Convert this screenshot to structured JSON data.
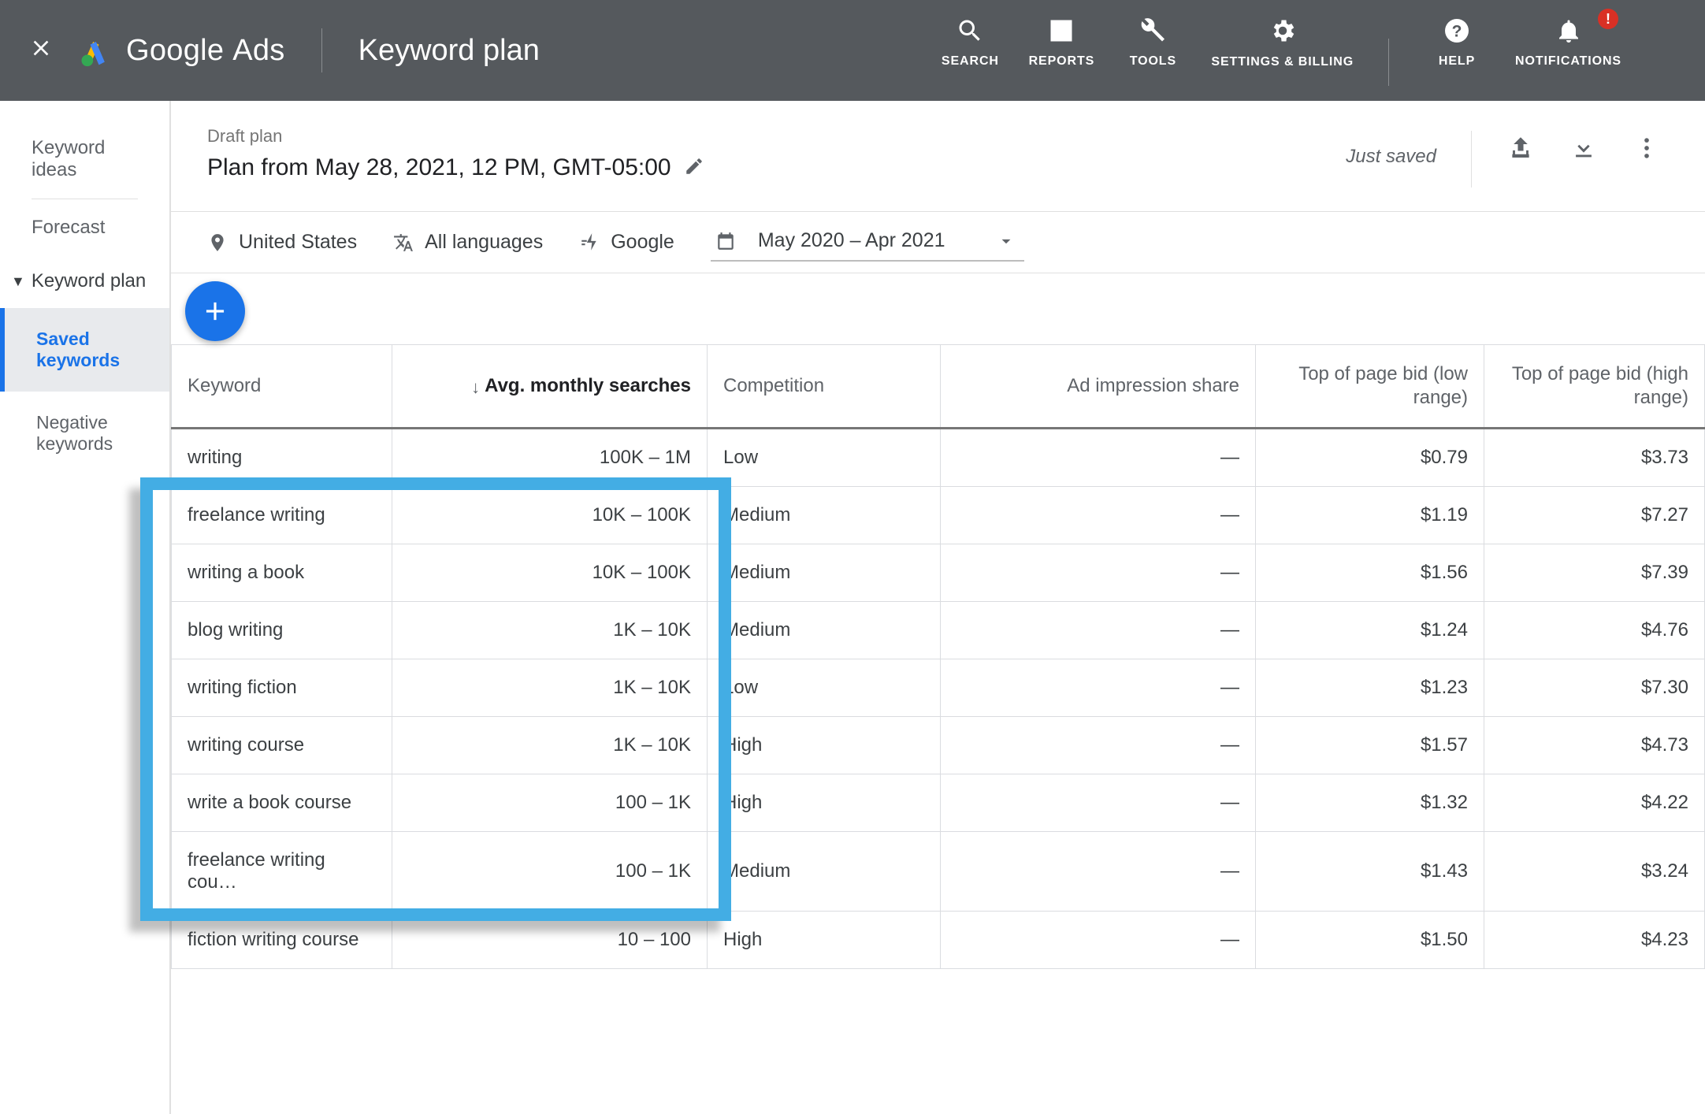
{
  "topbar": {
    "brand": "Google",
    "brand_suffix": "Ads",
    "page_title": "Keyword plan",
    "actions": {
      "search": "SEARCH",
      "reports": "REPORTS",
      "tools": "TOOLS",
      "billing": "SETTINGS & BILLING",
      "help": "HELP",
      "notifications": "NOTIFICATIONS",
      "notif_count": "!"
    }
  },
  "side": {
    "ideas": "Keyword ideas",
    "forecast": "Forecast",
    "plan": "Keyword plan",
    "saved": "Saved keywords",
    "negative": "Negative keywords"
  },
  "plan": {
    "label": "Draft plan",
    "name": "Plan from May 28, 2021, 12 PM, GMT-05:00",
    "status": "Just saved"
  },
  "filters": {
    "location": "United States",
    "language": "All languages",
    "network": "Google",
    "date": "May 2020 – Apr 2021"
  },
  "table": {
    "headers": {
      "keyword": "Keyword",
      "avg": "Avg. monthly searches",
      "competition": "Competition",
      "impression": "Ad impression share",
      "bid_low": "Top of page bid (low range)",
      "bid_high": "Top of page bid (high range)"
    },
    "rows": [
      {
        "keyword": "writing",
        "avg": "100K – 1M",
        "comp": "Low",
        "imp": "—",
        "low": "$0.79",
        "high": "$3.73"
      },
      {
        "keyword": "freelance writing",
        "avg": "10K – 100K",
        "comp": "Medium",
        "imp": "—",
        "low": "$1.19",
        "high": "$7.27"
      },
      {
        "keyword": "writing a book",
        "avg": "10K – 100K",
        "comp": "Medium",
        "imp": "—",
        "low": "$1.56",
        "high": "$7.39"
      },
      {
        "keyword": "blog writing",
        "avg": "1K – 10K",
        "comp": "Medium",
        "imp": "—",
        "low": "$1.24",
        "high": "$4.76"
      },
      {
        "keyword": "writing fiction",
        "avg": "1K – 10K",
        "comp": "Low",
        "imp": "—",
        "low": "$1.23",
        "high": "$7.30"
      },
      {
        "keyword": "writing course",
        "avg": "1K – 10K",
        "comp": "High",
        "imp": "—",
        "low": "$1.57",
        "high": "$4.73"
      },
      {
        "keyword": "write a book course",
        "avg": "100 – 1K",
        "comp": "High",
        "imp": "—",
        "low": "$1.32",
        "high": "$4.22"
      },
      {
        "keyword": "freelance writing cou…",
        "avg": "100 – 1K",
        "comp": "Medium",
        "imp": "—",
        "low": "$1.43",
        "high": "$3.24"
      },
      {
        "keyword": "fiction writing course",
        "avg": "10 – 100",
        "comp": "High",
        "imp": "—",
        "low": "$1.50",
        "high": "$4.23"
      }
    ]
  }
}
